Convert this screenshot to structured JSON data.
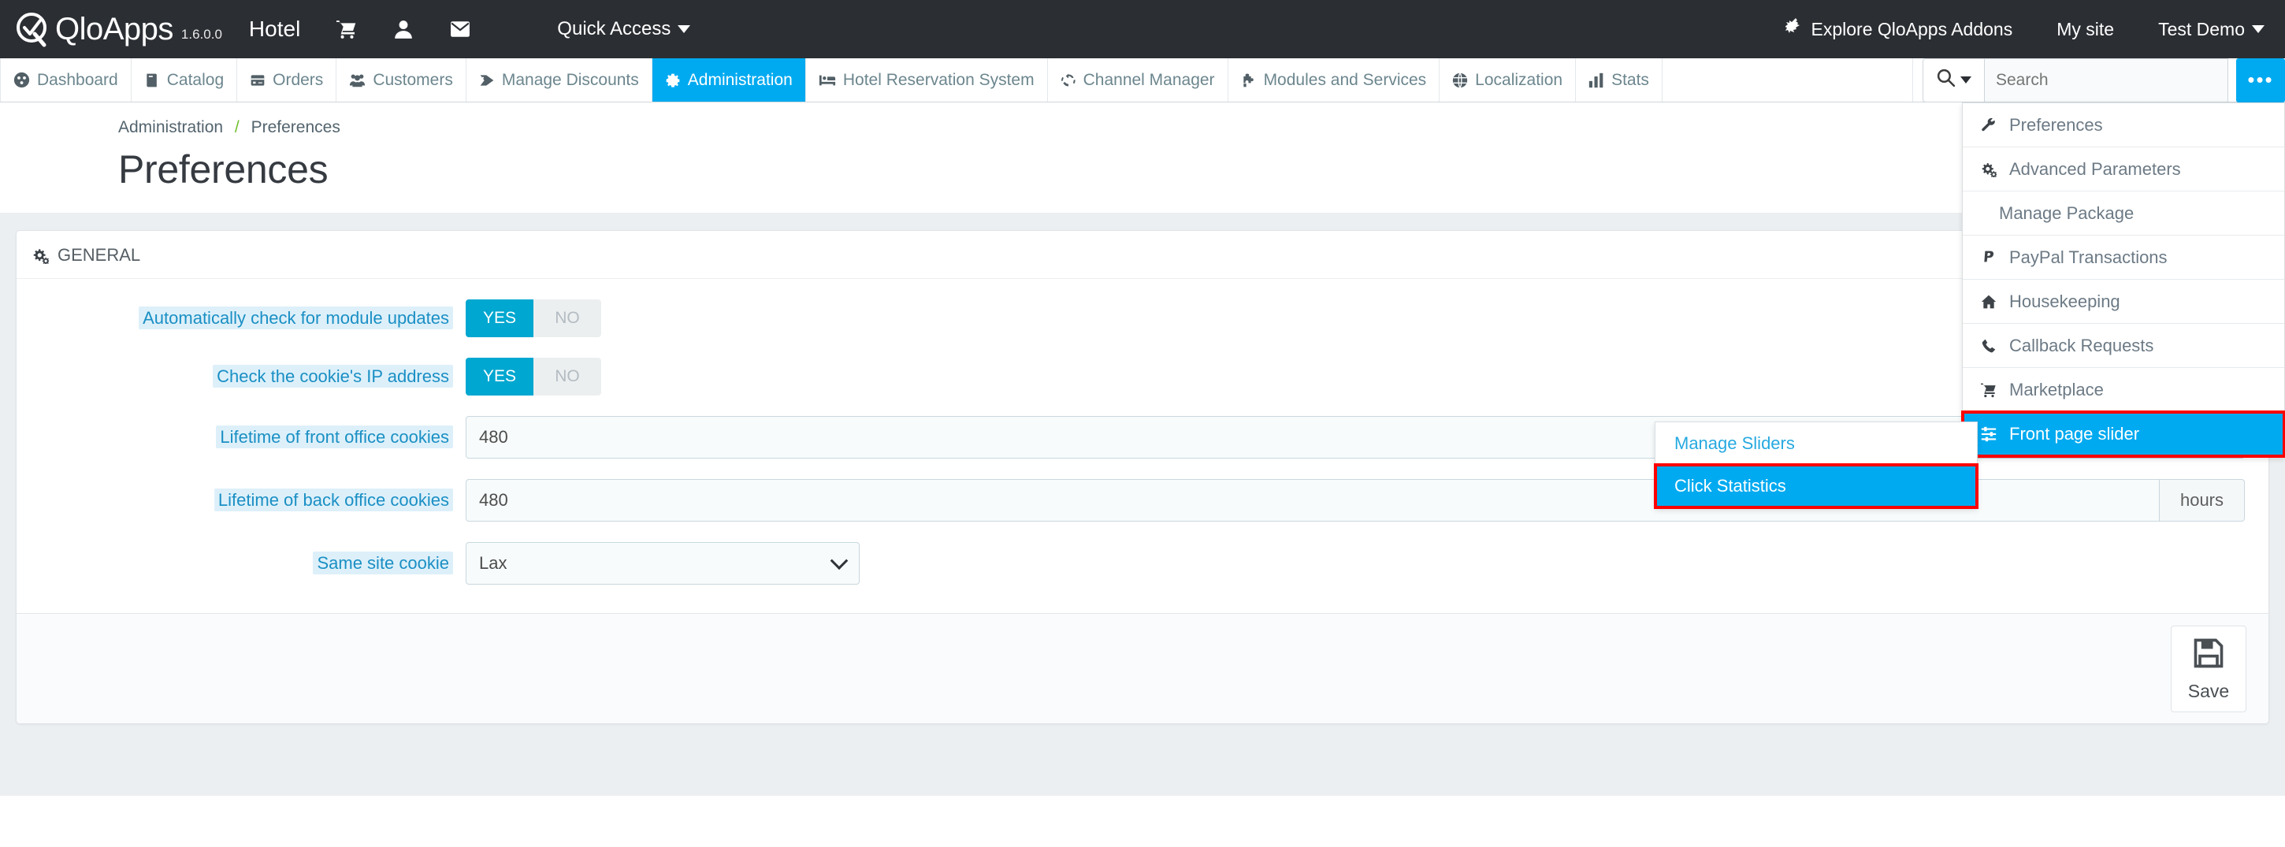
{
  "topbar": {
    "brand": "QloApps",
    "version": "1.6.0.0",
    "shop_name": "Hotel",
    "icons": [
      {
        "name": "cart-icon",
        "glyph": "cart"
      },
      {
        "name": "user-icon",
        "glyph": "user"
      },
      {
        "name": "envelope-icon",
        "glyph": "envelope"
      }
    ],
    "quick_access_label": "Quick Access",
    "addons_label": "Explore QloApps Addons",
    "my_site_label": "My site",
    "account_label": "Test Demo"
  },
  "menubar": {
    "items": [
      {
        "label": "Dashboard",
        "icon": "dashboard-icon",
        "active": false
      },
      {
        "label": "Catalog",
        "icon": "book-icon",
        "active": false
      },
      {
        "label": "Orders",
        "icon": "orders-icon",
        "active": false
      },
      {
        "label": "Customers",
        "icon": "customers-icon",
        "active": false
      },
      {
        "label": "Manage Discounts",
        "icon": "tag-icon",
        "active": false
      },
      {
        "label": "Administration",
        "icon": "gear-icon",
        "active": true
      },
      {
        "label": "Hotel Reservation System",
        "icon": "bed-icon",
        "active": false
      },
      {
        "label": "Channel Manager",
        "icon": "refresh-icon",
        "active": false
      },
      {
        "label": "Modules and Services",
        "icon": "puzzle-icon",
        "active": false
      },
      {
        "label": "Localization",
        "icon": "globe-icon",
        "active": false
      },
      {
        "label": "Stats",
        "icon": "chart-icon",
        "active": false
      }
    ],
    "search_placeholder": "Search",
    "search_value": "",
    "search_button_label": "•••"
  },
  "page": {
    "breadcrumb_parent": "Administration",
    "breadcrumb_sep": "/",
    "breadcrumb_current": "Preferences",
    "title": "Preferences"
  },
  "panel": {
    "header": "GENERAL",
    "rows": [
      {
        "type": "toggle",
        "label": "Automatically check for module updates",
        "yes_label": "YES",
        "no_label": "NO",
        "value": "YES"
      },
      {
        "type": "toggle",
        "label": "Check the cookie's IP address",
        "yes_label": "YES",
        "no_label": "NO",
        "value": "YES"
      },
      {
        "type": "input",
        "label": "Lifetime of front office cookies",
        "value": "480",
        "addon": "hours"
      },
      {
        "type": "input",
        "label": "Lifetime of back office cookies",
        "value": "480",
        "addon": "hours"
      },
      {
        "type": "select",
        "label": "Same site cookie",
        "value": "Lax"
      }
    ],
    "save_label": "Save"
  },
  "admin_dropdown": {
    "items": [
      {
        "label": "Preferences",
        "icon": "wrench-icon",
        "indent": false,
        "selected": false
      },
      {
        "label": "Advanced Parameters",
        "icon": "gears-icon",
        "indent": false,
        "selected": false
      },
      {
        "label": "Manage Package",
        "icon": "",
        "indent": true,
        "selected": false
      },
      {
        "label": "PayPal Transactions",
        "icon": "paypal-icon",
        "indent": false,
        "selected": false
      },
      {
        "label": "Housekeeping",
        "icon": "home-icon",
        "indent": false,
        "selected": false
      },
      {
        "label": "Callback Requests",
        "icon": "phone-icon",
        "indent": false,
        "selected": false
      },
      {
        "label": "Marketplace",
        "icon": "cart-icon",
        "indent": false,
        "selected": false
      },
      {
        "label": "Front page slider",
        "icon": "sliders-icon",
        "indent": false,
        "selected": true
      }
    ]
  },
  "sub_dropdown": {
    "items": [
      {
        "label": "Manage Sliders",
        "selected": false
      },
      {
        "label": "Click Statistics",
        "selected": true
      }
    ]
  },
  "colors": {
    "accent": "#00aaf0",
    "topbar_bg": "#2b2e33",
    "toggle_on": "#00a7d0",
    "highlight_outline": "#ff0000",
    "label_blue": "#1a8fc4",
    "breadcrumb_sep": "#72c02c"
  }
}
